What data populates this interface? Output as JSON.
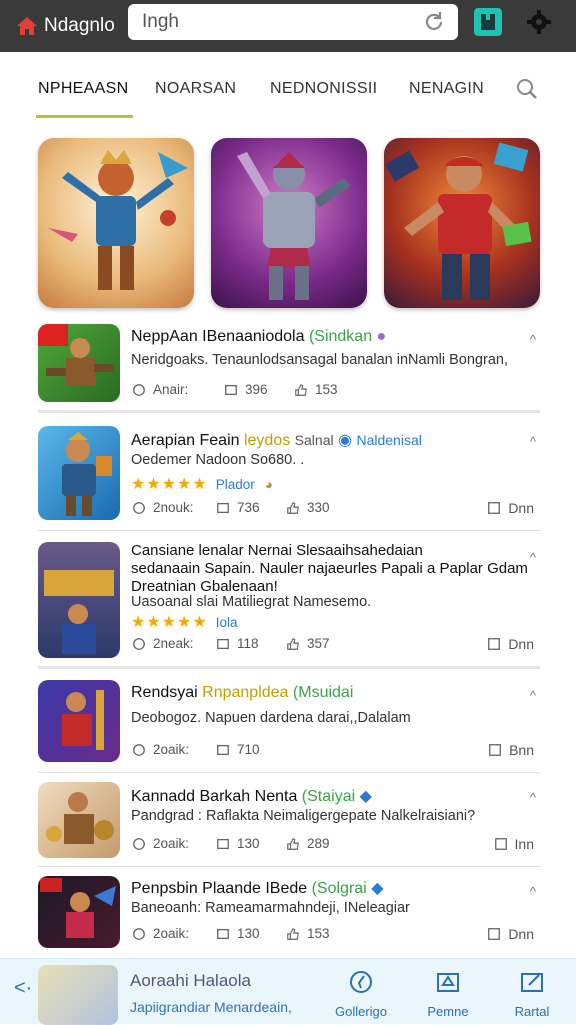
{
  "topbar": {
    "brand": "Ndagnlo",
    "search_value": "Ingh",
    "colors": {
      "bar": "#3a3a3a",
      "home": "#e0403a",
      "accent": "#1fc2b0"
    }
  },
  "tabs": [
    {
      "label": "NPHEAASN",
      "active": true
    },
    {
      "label": "NOARSAN"
    },
    {
      "label": "NEDNONISSII"
    },
    {
      "label": "NENAGIN"
    }
  ],
  "apps": [
    {
      "title": "NeppAan IBenaaniodola",
      "tag": "(Sindkan",
      "tag_color": "green",
      "desc": "Neridgoaks. Tenaunlodsansagal  banalan inNamli Bongran,",
      "meta1": "Anair:",
      "meta2": "396",
      "meta3": "153",
      "corner": "^"
    },
    {
      "title": "Aerapian Feain",
      "tag": "leydos",
      "tag_color": "yellow",
      "tag2": "Salnal",
      "tag3": "Naldenisal",
      "desc": "Oedemer Nadoon So680. .",
      "stars": "★★★★★",
      "rating_text": "Plador",
      "meta1": "2nouk:",
      "meta2": "736",
      "meta3": "330",
      "open": "Dnn",
      "corner": "^"
    },
    {
      "title": "Cansiane lenalar Nernai Slesaaihsahedaian",
      "title2": "sedanaain Sapain. Nauler najaeurles Papali a Paplar Gdam",
      "title3": "Dreatnian Gbalenaan!",
      "desc": "Uasoanal slai Matiliegrat Namesemo.",
      "stars": "★★★★★",
      "rating_text": "Iola",
      "meta1": "2neak:",
      "meta2": "118",
      "meta3": "357",
      "open": "Dnn",
      "corner": "^"
    },
    {
      "title": "Rendsyai",
      "tag": "Rnpanpldea",
      "tag_color": "yellow",
      "tag2": "(Msuidai",
      "desc": "Deobogoz. Napuen dardena darai,,Dalalam",
      "meta1": "2oaik:",
      "meta2": "710",
      "open": "Bnn",
      "corner": "^"
    },
    {
      "title": "Kannadd Barkah Nenta",
      "tag": "(Staiyai",
      "tag_color": "green",
      "desc": "Pandgrad : Raflakta Neimaligergepate Nalkelraisiani?",
      "meta1": "2oaik:",
      "meta2": "130",
      "meta3": "289",
      "open": "Inn",
      "corner": "^"
    },
    {
      "title": "Penpsbin Plaande IBede",
      "tag": "(Solgrai",
      "tag_color": "green",
      "desc": "Baneoanh: Rameamarmahndeji, INeleagiar",
      "meta1": "2oaik:",
      "meta2": "130",
      "meta3": "153",
      "open": "Dnn",
      "corner": "^"
    }
  ],
  "bottom": {
    "title": "Aoraahi Halaola",
    "subtitle": "Japiigrandiar Menardeain,",
    "nav": [
      {
        "label": "Gollerigo",
        "icon": "compass-icon"
      },
      {
        "label": "Pemne",
        "icon": "upload-icon"
      },
      {
        "label": "Rartal",
        "icon": "edit-icon"
      }
    ]
  }
}
